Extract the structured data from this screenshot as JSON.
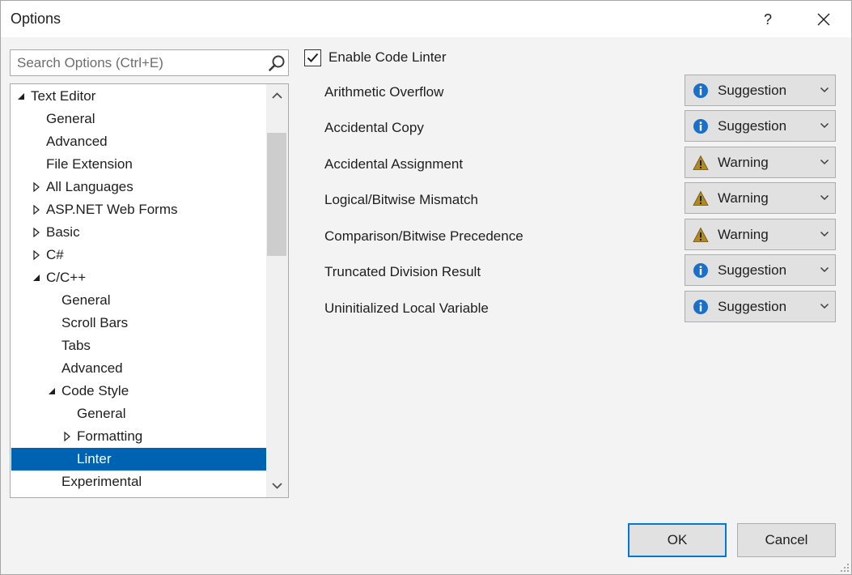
{
  "window": {
    "title": "Options",
    "help_label": "?"
  },
  "search": {
    "placeholder": "Search Options (Ctrl+E)",
    "value": ""
  },
  "tree": {
    "items": [
      {
        "label": "Text Editor",
        "expander": "expanded"
      },
      {
        "label": "General",
        "expander": "none"
      },
      {
        "label": "Advanced",
        "expander": "none"
      },
      {
        "label": "File Extension",
        "expander": "none"
      },
      {
        "label": "All Languages",
        "expander": "collapsed"
      },
      {
        "label": "ASP.NET Web Forms",
        "expander": "collapsed"
      },
      {
        "label": "Basic",
        "expander": "collapsed"
      },
      {
        "label": "C#",
        "expander": "collapsed"
      },
      {
        "label": "C/C++",
        "expander": "expanded"
      },
      {
        "label": "General",
        "expander": "none"
      },
      {
        "label": "Scroll Bars",
        "expander": "none"
      },
      {
        "label": "Tabs",
        "expander": "none"
      },
      {
        "label": "Advanced",
        "expander": "none"
      },
      {
        "label": "Code Style",
        "expander": "expanded"
      },
      {
        "label": "General",
        "expander": "none"
      },
      {
        "label": "Formatting",
        "expander": "collapsed"
      },
      {
        "label": "Linter",
        "expander": "none",
        "selected": true
      },
      {
        "label": "Experimental",
        "expander": "none"
      }
    ]
  },
  "linter": {
    "enable_label": "Enable Code Linter",
    "enabled": true,
    "rules": [
      {
        "label": "Arithmetic Overflow",
        "severity": "Suggestion",
        "icon": "info-icon"
      },
      {
        "label": "Accidental Copy",
        "severity": "Suggestion",
        "icon": "info-icon"
      },
      {
        "label": "Accidental Assignment",
        "severity": "Warning",
        "icon": "warning-icon"
      },
      {
        "label": "Logical/Bitwise Mismatch",
        "severity": "Warning",
        "icon": "warning-icon"
      },
      {
        "label": "Comparison/Bitwise Precedence",
        "severity": "Warning",
        "icon": "warning-icon"
      },
      {
        "label": "Truncated Division Result",
        "severity": "Suggestion",
        "icon": "info-icon"
      },
      {
        "label": "Uninitialized Local Variable",
        "severity": "Suggestion",
        "icon": "info-icon"
      }
    ]
  },
  "buttons": {
    "ok_label": "OK",
    "cancel_label": "Cancel"
  },
  "colors": {
    "selection": "#0063b1",
    "info": "#1a6fc9",
    "warning": "#b08a1e",
    "ok_border": "#0078d7"
  }
}
